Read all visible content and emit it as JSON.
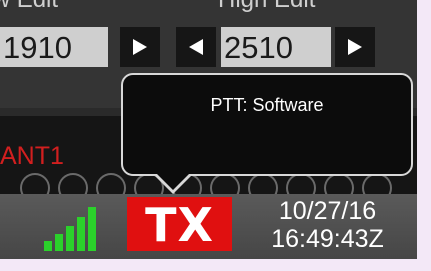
{
  "header": {
    "low_label": "Low Edit",
    "high_label": "High Edit"
  },
  "low_edge": {
    "value": "1910"
  },
  "high_edge": {
    "value": "2510"
  },
  "antenna": {
    "label": "ANT1"
  },
  "tooltip": {
    "text": "PTT: Software"
  },
  "status": {
    "tx_label": "TX",
    "date": "10/27/16",
    "time": "16:49:43Z",
    "signal_bars_lit": 5,
    "signal_bars_total": 5
  },
  "colors": {
    "tx_background": "#e01010",
    "signal_green": "#2bd12b",
    "antenna_red": "#d21f1f"
  },
  "icons": [
    "arrow-right-icon",
    "arrow-left-icon",
    "signal-strength-icon"
  ]
}
